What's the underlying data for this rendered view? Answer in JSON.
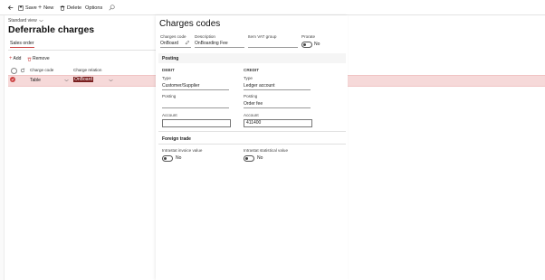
{
  "toolbar": {
    "save_label": "Save",
    "new_label": "New",
    "delete_label": "Delete",
    "options_label": "Options"
  },
  "left": {
    "view_label": "Standard view",
    "page_title": "Deferrable charges",
    "tab_label": "Sales order",
    "actions": {
      "add_label": "Add",
      "remove_label": "Remove"
    },
    "grid": {
      "columns": [
        "Charge code",
        "Charge relation"
      ],
      "rows": [
        {
          "charge_code": "Table",
          "charge_relation": "OnBoard"
        }
      ]
    }
  },
  "panel": {
    "title": "Charges codes",
    "fields": {
      "charges_code_label": "Charges code",
      "charges_code_value": "OnBoard",
      "description_label": "Description",
      "description_value": "OnBoarding Fee",
      "item_vat_label": "Item VAT group",
      "item_vat_value": "",
      "prorate_label": "Prorate",
      "prorate_value": "No"
    },
    "posting": {
      "title": "Posting",
      "debit_header": "DEBIT",
      "credit_header": "CREDIT",
      "debit_type_label": "Type",
      "debit_type_value": "Customer/Supplier",
      "credit_type_label": "Type",
      "credit_type_value": "Ledger account",
      "debit_posting_label": "Posting",
      "debit_posting_value": "",
      "credit_posting_label": "Posting",
      "credit_posting_value": "Order fee",
      "debit_account_label": "Account",
      "debit_account_value": "",
      "credit_account_label": "Account",
      "credit_account_value": "411400"
    },
    "foreign_trade": {
      "title": "Foreign trade",
      "invoice_label": "Intrastat invoice value",
      "invoice_value": "No",
      "statistical_label": "Intrastat statistical value",
      "statistical_value": "No"
    }
  },
  "colors": {
    "accent": "#c44444",
    "selected_row": "#f6d9d9",
    "selected_cell": "#7a1f1f"
  }
}
